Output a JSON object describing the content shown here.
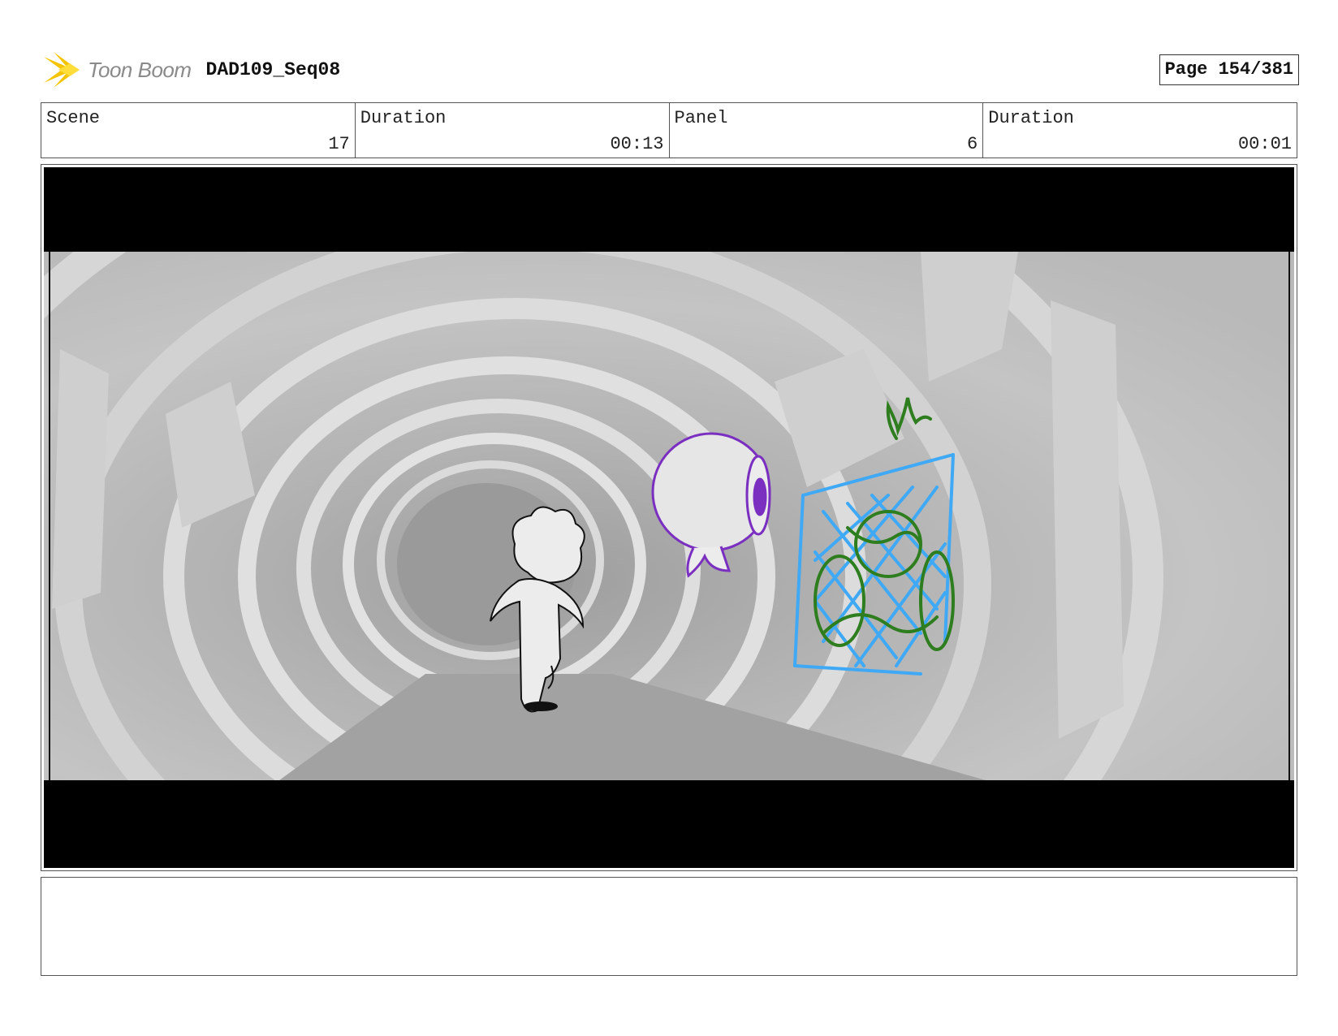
{
  "header": {
    "logo_text": "Toon Boom",
    "sequence_title": "DAD109_Seq08",
    "page_label": "Page 154/381"
  },
  "info": {
    "scene_label": "Scene",
    "scene_value": "17",
    "scene_duration_label": "Duration",
    "scene_duration_value": "00:13",
    "panel_label": "Panel",
    "panel_value": "6",
    "panel_duration_label": "Duration",
    "panel_duration_value": "00:01"
  },
  "notes": {
    "text": ""
  },
  "colors": {
    "logo_star": "#f5c400",
    "tunnel_gray": "#a9a9a9",
    "eyeball_purple": "#7a2fc0",
    "vent_blue": "#3fa9f5",
    "plant_green": "#2e7d1e"
  }
}
